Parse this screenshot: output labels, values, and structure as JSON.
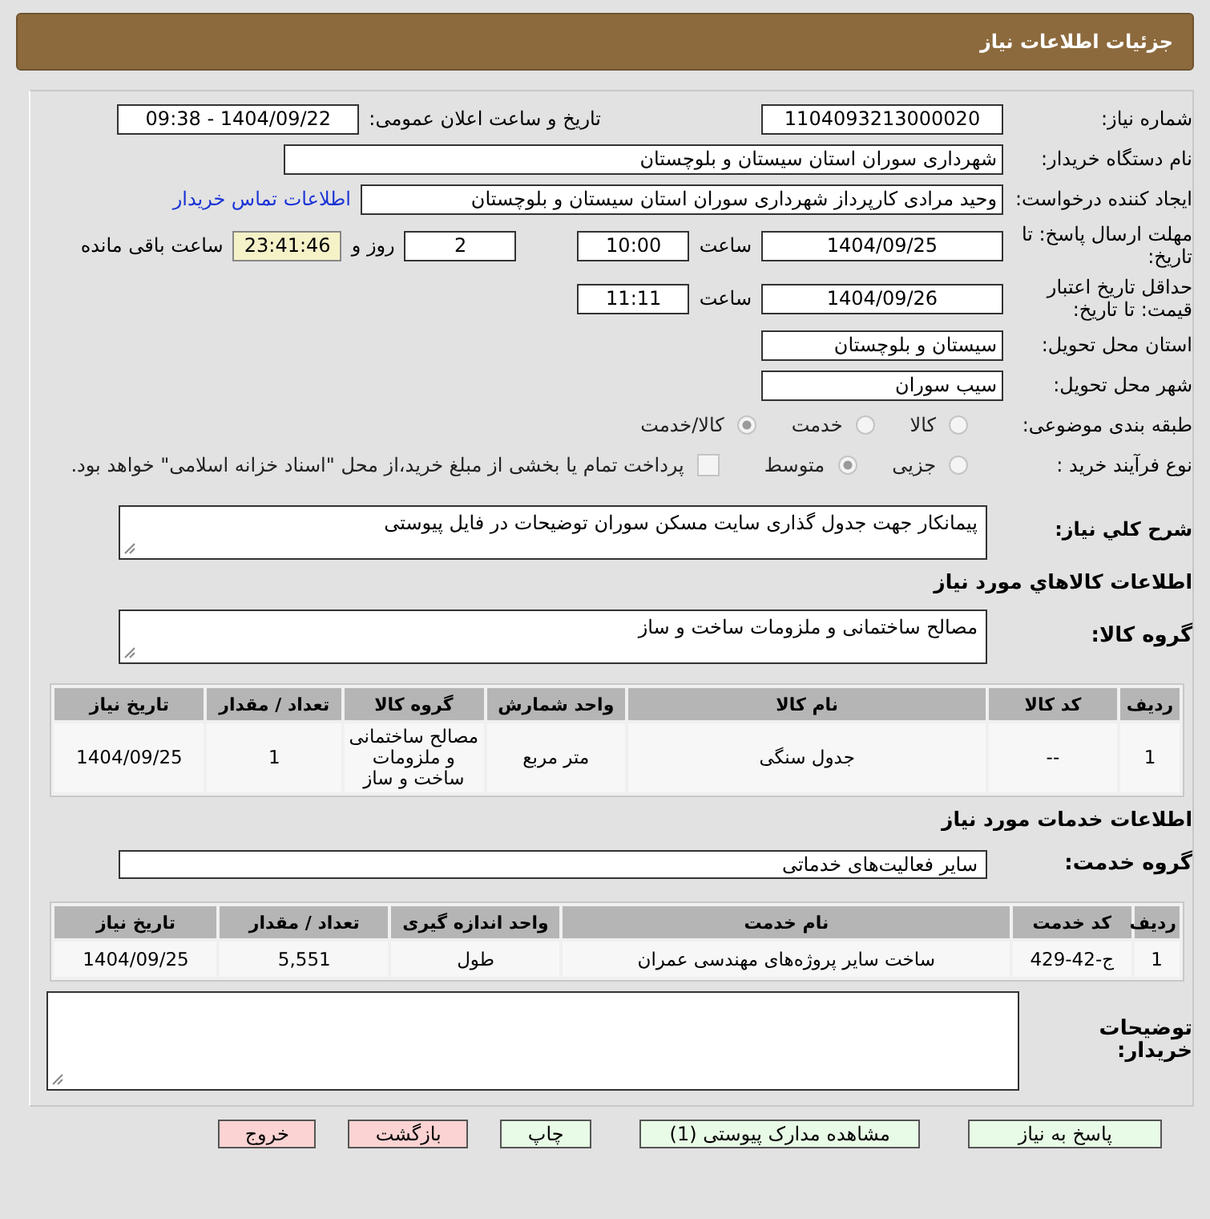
{
  "header": {
    "title": "جزئیات اطلاعات نیاز"
  },
  "need_number": {
    "label": "شماره نیاز:",
    "value": "1104093213000020"
  },
  "announce": {
    "label": "تاریخ و ساعت اعلان عمومی:",
    "value": "1404/09/22 - 09:38"
  },
  "buyer": {
    "label": "نام دستگاه خریدار:",
    "value": "شهرداری سوران استان سیستان و بلوچستان"
  },
  "creator": {
    "label": "ایجاد کننده درخواست:",
    "value": "وحید مرادی کارپرداز شهرداری سوران استان سیستان و بلوچستان",
    "link": "اطلاعات تماس خریدار"
  },
  "deadline": {
    "label": "مهلت ارسال پاسخ: تا تاریخ:",
    "date": "1404/09/25",
    "time_label": "ساعت",
    "time": "10:00",
    "days": "2",
    "days_label": "روز و",
    "remaining": "23:41:46",
    "remaining_label": "ساعت باقی مانده"
  },
  "validity": {
    "label": "حداقل تاریخ اعتبار قیمت: تا تاریخ:",
    "date": "1404/09/26",
    "time_label": "ساعت",
    "time": "11:11"
  },
  "province": {
    "label": "استان محل تحویل:",
    "value": "سیستان و بلوچستان"
  },
  "city": {
    "label": "شهر محل تحویل:",
    "value": "سیب سوران"
  },
  "category": {
    "label": "طبقه بندی موضوعی:",
    "options": [
      {
        "label": "کالا",
        "selected": false
      },
      {
        "label": "خدمت",
        "selected": false
      },
      {
        "label": "کالا/خدمت",
        "selected": true
      }
    ]
  },
  "process": {
    "label": "نوع فرآیند خرید :",
    "options": [
      {
        "label": "جزیی",
        "selected": false
      },
      {
        "label": "متوسط",
        "selected": true
      }
    ],
    "treasury": {
      "checked": false,
      "text": "پرداخت تمام یا بخشی از مبلغ خرید،از محل \"اسناد خزانه اسلامی\" خواهد بود."
    }
  },
  "description": {
    "label": "شرح کلي نياز:",
    "value": "پیمانکار جهت جدول گذاری سایت مسکن سوران توضیحات در فایل پیوستی"
  },
  "goods_heading": "اطلاعات کالاهاي مورد نياز",
  "goods_group": {
    "label": "گروه کالا:",
    "value": "مصالح ساختمانی و ملزومات ساخت و ساز"
  },
  "goods_table": {
    "columns": [
      "ردیف",
      "کد کالا",
      "نام کالا",
      "واحد شمارش",
      "گروه کالا",
      "تعداد / مقدار",
      "تاریخ نیاز"
    ],
    "rows": [
      [
        "1",
        "--",
        "جدول سنگی",
        "متر مربع",
        "مصالح ساختمانی و ملزومات ساخت و ساز",
        "1",
        "1404/09/25"
      ]
    ]
  },
  "services_heading": "اطلاعات خدمات مورد نیاز",
  "service_group": {
    "label": "گروه خدمت:",
    "value": "سایر فعالیت‌های خدماتی"
  },
  "services_table": {
    "columns": [
      "ردیف",
      "کد خدمت",
      "نام خدمت",
      "واحد اندازه گیری",
      "تعداد / مقدار",
      "تاریخ نیاز"
    ],
    "rows": [
      [
        "1",
        "ج-42-429",
        "ساخت سایر پروژه‌های مهندسی عمران",
        "طول",
        "5,551",
        "1404/09/25"
      ]
    ]
  },
  "buyer_notes": {
    "label": "توضیحات خریدار:"
  },
  "buttons": [
    {
      "label": "پاسخ به نیاز",
      "kind": "action"
    },
    {
      "label": "مشاهده مدارک پیوستی (1)",
      "kind": "action"
    },
    {
      "label": "چاپ",
      "kind": "action"
    },
    {
      "label": "بازگشت",
      "kind": "exit"
    },
    {
      "label": "خروج",
      "kind": "exit"
    }
  ]
}
